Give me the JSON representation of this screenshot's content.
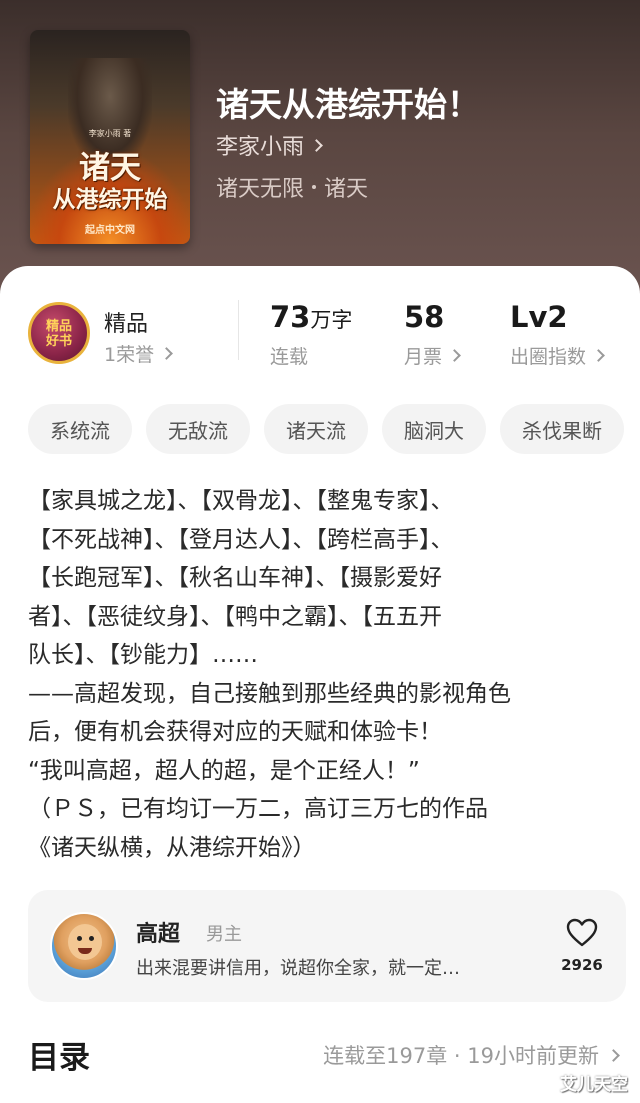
{
  "cover": {
    "author_small": "李家小雨 著",
    "title_line1": "诸天",
    "title_line2": "从港综开始",
    "publisher": "起点中文网"
  },
  "book": {
    "title": "诸天从港综开始！",
    "author": "李家小雨",
    "genre_main": "诸天无限",
    "genre_sub": "诸天"
  },
  "stats": {
    "badge_text": "精品\n好书",
    "quality_label": "精品",
    "honors": "1荣誉",
    "word_count_num": "73",
    "word_count_unit": "万字",
    "status": "连载",
    "tickets_num": "58",
    "tickets_label": "月票",
    "level": "Lv2",
    "level_label": "出圈指数"
  },
  "tags": [
    "系统流",
    "无敌流",
    "诸天流",
    "脑洞大",
    "杀伐果断"
  ],
  "intro_lines": [
    "【家具城之龙】、【双骨龙】、【整鬼专家】、",
    "【不死战神】、【登月达人】、【跨栏高手】、",
    "【长跑冠军】、【秋名山车神】、【摄影爱好",
    "者】、【恶徒纹身】、【鸭中之霸】、【五五开",
    "队长】、【钞能力】……",
    "——高超发现，自己接触到那些经典的影视角色",
    "后，便有机会获得对应的天赋和体验卡！",
    "“我叫高超，超人的超，是个正经人！”",
    "（ＰＳ，已有均订一万二，高订三万七的作品",
    "《诸天纵横，从港综开始》）"
  ],
  "character": {
    "name": "高超",
    "role": "男主",
    "quote": "出来混要讲信用，说超你全家，就一定…",
    "likes": "2926"
  },
  "toc": {
    "title": "目录",
    "meta": "连载至197章 · 19小时前更新"
  },
  "watermark": "艾儿天空",
  "colors": {
    "hero_bg": "#5a4641",
    "tag_bg": "#f3f3f3",
    "card_bg": "#f5f5f5",
    "muted_text": "#9a9a9a"
  }
}
